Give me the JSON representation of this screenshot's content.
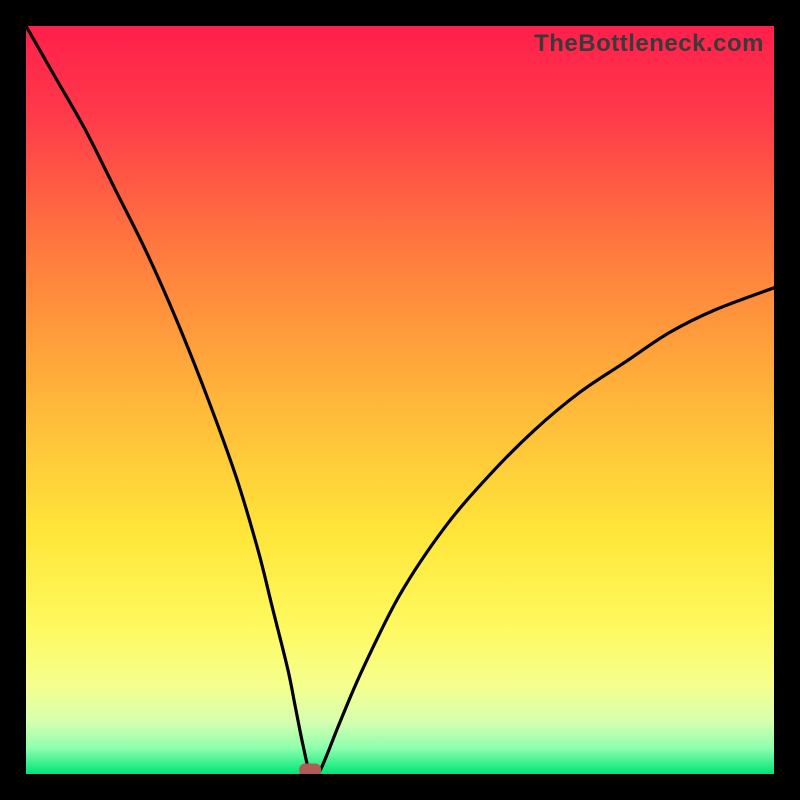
{
  "watermark": "TheBottleneck.com",
  "chart_data": {
    "type": "line",
    "title": "",
    "xlabel": "",
    "ylabel": "",
    "xlim": [
      0,
      100
    ],
    "ylim": [
      0,
      100
    ],
    "grid": false,
    "legend": false,
    "notes": "Bottleneck-style curve: a V-shaped black curve over a vertical red→yellow→green gradient. The curve minimum (≈0) occurs near x≈38; left branch starts near (0,100), right branch ends near (100,65). A small rounded red marker sits at the minimum point on the baseline.",
    "series": [
      {
        "name": "bottleneck-curve",
        "x": [
          0,
          4,
          8,
          12,
          16,
          20,
          24,
          28,
          31,
          33,
          35,
          36,
          37,
          38,
          39,
          40,
          42,
          45,
          50,
          56,
          62,
          68,
          74,
          80,
          86,
          92,
          100
        ],
        "values": [
          100,
          93,
          86,
          78,
          70,
          61,
          51,
          40,
          30,
          22,
          14,
          9,
          4,
          0,
          0,
          2,
          7,
          14,
          24,
          33,
          40,
          46,
          51,
          55,
          59,
          62,
          65
        ]
      }
    ],
    "marker": {
      "x": 38,
      "y": 0,
      "color": "#b15a56"
    },
    "gradient_stops": [
      {
        "offset": 0.0,
        "color": "#ff1f4b"
      },
      {
        "offset": 0.12,
        "color": "#ff3a4a"
      },
      {
        "offset": 0.3,
        "color": "#ff7a3e"
      },
      {
        "offset": 0.5,
        "color": "#ffb63a"
      },
      {
        "offset": 0.68,
        "color": "#ffe63a"
      },
      {
        "offset": 0.8,
        "color": "#fff95e"
      },
      {
        "offset": 0.88,
        "color": "#f6ff8c"
      },
      {
        "offset": 0.93,
        "color": "#d6ffb0"
      },
      {
        "offset": 0.965,
        "color": "#8effad"
      },
      {
        "offset": 1.0,
        "color": "#00e47a"
      }
    ]
  }
}
